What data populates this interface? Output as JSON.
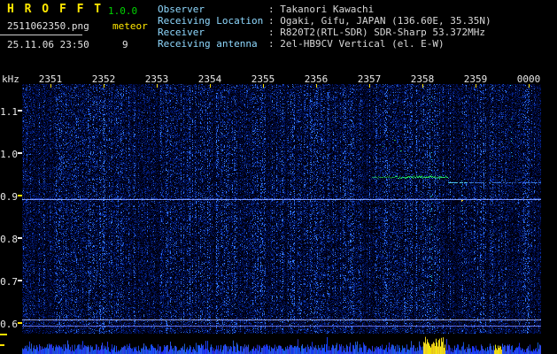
{
  "app": {
    "title": "H R O F F T",
    "version": "1.0.0",
    "filename": "2511062350.png",
    "mode": "meteor",
    "datetime": "25.11.06 23:50",
    "echo_count": "9"
  },
  "station_info": {
    "rows": [
      {
        "label": "Observer",
        "value": ": Takanori Kawachi"
      },
      {
        "label": "Receiving Location",
        "value": ": Ogaki, Gifu, JAPAN (136.60E, 35.35N)"
      },
      {
        "label": "Receiver",
        "value": ": R820T2(RTL-SDR) SDR-Sharp 53.372MHz"
      },
      {
        "label": "Receiving antenna",
        "value": ": 2el-HB9CV Vertical (el. E-W)"
      }
    ]
  },
  "axes": {
    "freq_unit": "kHz",
    "freq_top": 1.1625,
    "freq_bottom": 0.575,
    "freq_ticks": [
      {
        "label": "1.1",
        "tick_color": "#e8e8e8"
      },
      {
        "label": "1.0",
        "tick_color": "#e8e8e8"
      },
      {
        "label": "0.9",
        "tick_color": "#ffe000"
      },
      {
        "label": "0.8",
        "tick_color": "#e8e8e8"
      },
      {
        "label": "0.7",
        "tick_color": "#e8e8e8"
      },
      {
        "label": "0.6",
        "tick_color": "#ffe000"
      }
    ],
    "time_ticks": [
      "2351",
      "2352",
      "2353",
      "2354",
      "2355",
      "2356",
      "2357",
      "2358",
      "2359",
      "0000"
    ]
  },
  "colors": {
    "title": "#ffe800",
    "version": "#00d400",
    "mode": "#ffe800",
    "info_label": "#8fd9ff",
    "info_value": "#d8d8d8",
    "axis_text": "#e8e8e8",
    "noise_blue": "#2233cc",
    "meteor_green": "#35e06a",
    "active_yellow": "#ffd400"
  },
  "spectrogram": {
    "noise_seed": 1337,
    "carrier_line": {
      "freq_khz": 0.89
    },
    "cal_lines": [
      {
        "freq_khz": 0.606
      },
      {
        "freq_khz": 0.592
      }
    ],
    "meteor_trail": {
      "freq_khz": 0.944,
      "x_frac": [
        0.674,
        0.819
      ]
    },
    "trail_tail": {
      "freq_khz": 0.931,
      "x_frac": [
        0.819,
        1.0
      ]
    },
    "speck_columns": [
      {
        "x_frac": 0.788,
        "y_frac": [
          0.0,
          1.0
        ]
      },
      {
        "x_frac": 0.846,
        "y_frac": [
          0.38,
          0.56
        ]
      },
      {
        "x_frac": 0.942,
        "y_frac": [
          0.0,
          0.3
        ]
      }
    ],
    "specks": [
      {
        "x_frac": 0.694,
        "freq_khz": 1.017
      },
      {
        "x_frac": 0.717,
        "freq_khz": 1.031
      },
      {
        "x_frac": 0.729,
        "freq_khz": 1.006
      }
    ],
    "yellow_mark": {
      "x_frac": 0.846,
      "freq_khz": 0.888
    }
  },
  "level_strip": {
    "active_regions": [
      {
        "x_frac": [
          0.773,
          0.814
        ],
        "h_min": 7,
        "h_max": 20
      },
      {
        "x_frac": [
          0.909,
          0.923
        ],
        "h_min": 4,
        "h_max": 11
      }
    ]
  }
}
